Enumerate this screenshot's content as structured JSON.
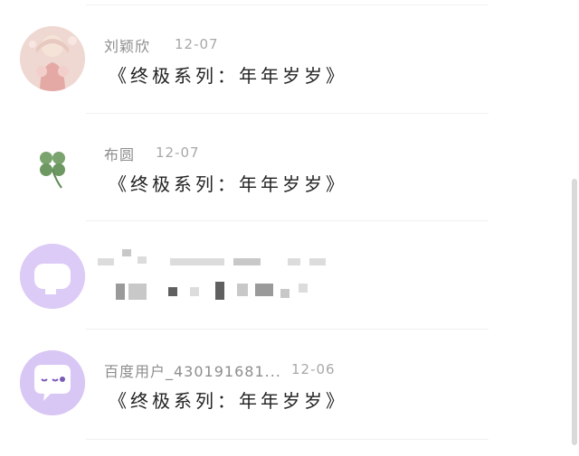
{
  "comments": [
    {
      "username": "刘颖欣",
      "time": "12-07",
      "content": "《终极系列：年年岁岁》",
      "avatar_icon": "girl-photo-avatar"
    },
    {
      "username": "布圆",
      "time": "12-07",
      "content": "《终极系列：年年岁岁》",
      "avatar_icon": "clover-icon"
    },
    {
      "username": "",
      "time": "",
      "content": "",
      "avatar_icon": "chat-bubble-avatar",
      "blurred": true
    },
    {
      "username": "百度用户_430191681...",
      "time": "12-06",
      "content": "《终极系列：年年岁岁》",
      "avatar_icon": "chat-bubble-avatar"
    }
  ],
  "colors": {
    "avatar_purple": "#d8c6f5",
    "avatar_pink": "#f0d6d2",
    "clover_green": "#7aa36d",
    "scrollbar": "#d9d9d9"
  }
}
